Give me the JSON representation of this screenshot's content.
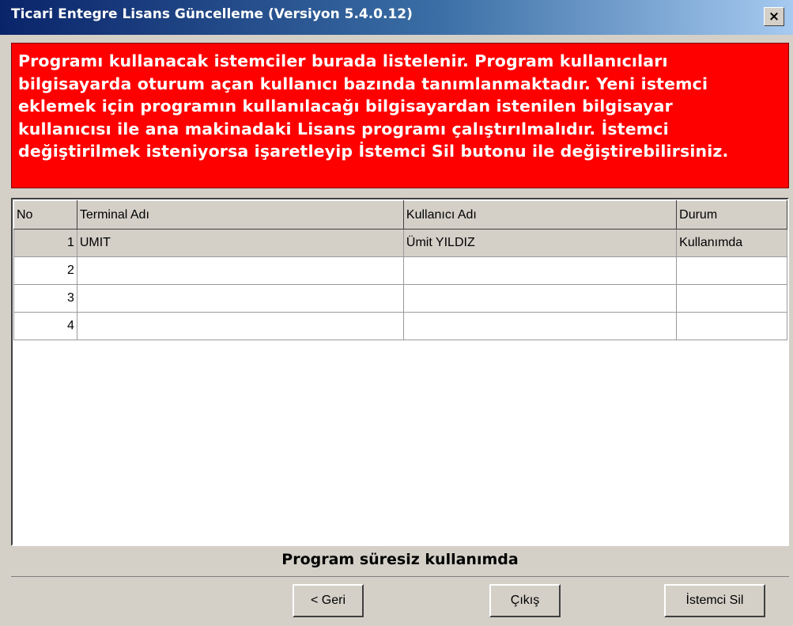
{
  "window": {
    "title": "Ticari Entegre Lisans Güncelleme (Versiyon 5.4.0.12)",
    "close_label": "×"
  },
  "warning": {
    "lines": [
      "Programı kullanacak istemciler burada listelenir. Program kullanıcıları",
      "bilgisayarda oturum açan kullanıcı bazında tanımlanmaktadır. Yeni istemci",
      "eklemek için programın kullanılacağı bilgisayardan istenilen bilgisayar",
      "kullanıcısı ile ana makinadaki Lisans programı çalıştırılmalıdır. İstemci",
      "değiştirilmek isteniyorsa işaretleyip İstemci Sil butonu ile değiştirebilirsiniz."
    ],
    "colors": {
      "background": "#ff0000",
      "text": "#ffffff"
    }
  },
  "grid": {
    "columns": [
      "No",
      "Terminal Adı",
      "Kullanıcı Adı",
      "Durum"
    ],
    "rows": [
      {
        "no": "1",
        "terminal": "UMIT",
        "user": "Ümit YILDIZ",
        "status": "Kullanımda"
      },
      {
        "no": "2",
        "terminal": "",
        "user": "",
        "status": ""
      },
      {
        "no": "3",
        "terminal": "",
        "user": "",
        "status": ""
      },
      {
        "no": "4",
        "terminal": "",
        "user": "",
        "status": ""
      }
    ]
  },
  "status": {
    "text": "Program süresiz kullanımda"
  },
  "buttons": {
    "back_label": "< Geri",
    "exit_label": "Çıkış",
    "delete_client_label": "İstemci Sil"
  }
}
